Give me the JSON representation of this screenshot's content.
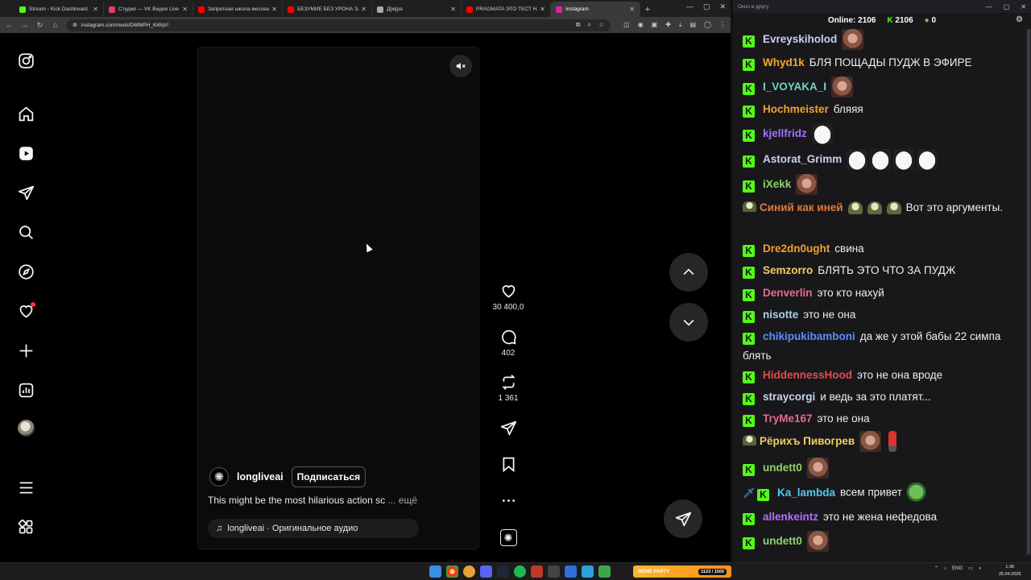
{
  "browser": {
    "tabs": [
      {
        "title": "Stream - Kick Dashboard",
        "color": "#53fc18"
      },
      {
        "title": "Студия — VK Видео Live",
        "color": "#e4405f"
      },
      {
        "title": "Запретная школа мессенд...",
        "color": "#ff0000"
      },
      {
        "title": "БЕЗУМИЕ БЕЗ УРОНА ЗА i",
        "color": "#ff0000"
      },
      {
        "title": "Д[м]ра",
        "color": "#aaaaaa"
      },
      {
        "title": "PRAGMATA ЭТО ТЕСТ НА Р...",
        "color": "#ff0000"
      },
      {
        "title": "Instagram",
        "color": "#d6249f",
        "active": true
      }
    ],
    "url": "instagram.com/reels/DWMPH_KkfqV/"
  },
  "instagram": {
    "reel": {
      "username": "longliveai",
      "follow_label": "Подписаться",
      "caption": "This might be the most hilarious action sc",
      "caption_more": "... ещё",
      "audio": "longliveai · Оригинальное аудио"
    },
    "counts": {
      "likes": "30 400,0",
      "comments": "402",
      "reposts": "1 361"
    }
  },
  "chat": {
    "window_title": "Окно в другу",
    "online_label": "Online:",
    "online_count": "2106",
    "viewers": "2106",
    "coins": "0",
    "messages": [
      {
        "user": "Evreyskiholod",
        "color": "#c8d1f0",
        "text": ""
      },
      {
        "user": "Whyd1k",
        "color": "#f5a623",
        "text": "БЛЯ ПОЩАДЫ ПУДЖ В ЭФИРЕ"
      },
      {
        "user": "I_VOYAKA_I",
        "color": "#70d4c4",
        "text": ""
      },
      {
        "user": "Hochmeister",
        "color": "#f0a030",
        "text": "бляяя"
      },
      {
        "user": "kjellfridz",
        "color": "#a070ff",
        "text": ""
      },
      {
        "user": "Astorat_Grimm",
        "color": "#c8d1f0",
        "text": ""
      },
      {
        "user": "iXekk",
        "color": "#8fd26a",
        "text": ""
      },
      {
        "user": "Синий как иней",
        "color": "#e07a3a",
        "text": "Вот это аргументы."
      },
      {
        "user": "Dre2dn0ught",
        "color": "#f0a030",
        "text": "свина"
      },
      {
        "user": "Semzorro",
        "color": "#f0d060",
        "text": "БЛЯТЬ ЭТО ЧТО ЗА ПУДЖ"
      },
      {
        "user": "Denverlin",
        "color": "#e86a8a",
        "text": "это кто нахуй"
      },
      {
        "user": "nisotte",
        "color": "#a8d0f0",
        "text": "это не она"
      },
      {
        "user": "chikipukibamboni",
        "color": "#5a8cff",
        "text": "да же у этой бабы 22 симпа блять"
      },
      {
        "user": "HiddennessHood",
        "color": "#e84a4a",
        "text": "это не она вроде"
      },
      {
        "user": "straycorgi",
        "color": "#c8d1f0",
        "text": "и ведь за это платят..."
      },
      {
        "user": "TryMe167",
        "color": "#e86a8a",
        "text": "это не она"
      },
      {
        "user": "Рёрихъ Пивогрев",
        "color": "#f0d060",
        "text": ""
      },
      {
        "user": "undett0",
        "color": "#8fd26a",
        "text": ""
      },
      {
        "user": "Ka_lambda",
        "color": "#53c8f0",
        "text": "всем привет"
      },
      {
        "user": "allenkeintz",
        "color": "#b070ff",
        "text": "это не жена нефедова"
      },
      {
        "user": "undett0",
        "color": "#8fd26a",
        "text": ""
      }
    ]
  },
  "taskbar": {
    "widget_title": "MEME PARTY",
    "widget_count": "1123 / 1500",
    "lang": "ENG",
    "time": "1:36",
    "date": "25.04.2026"
  }
}
